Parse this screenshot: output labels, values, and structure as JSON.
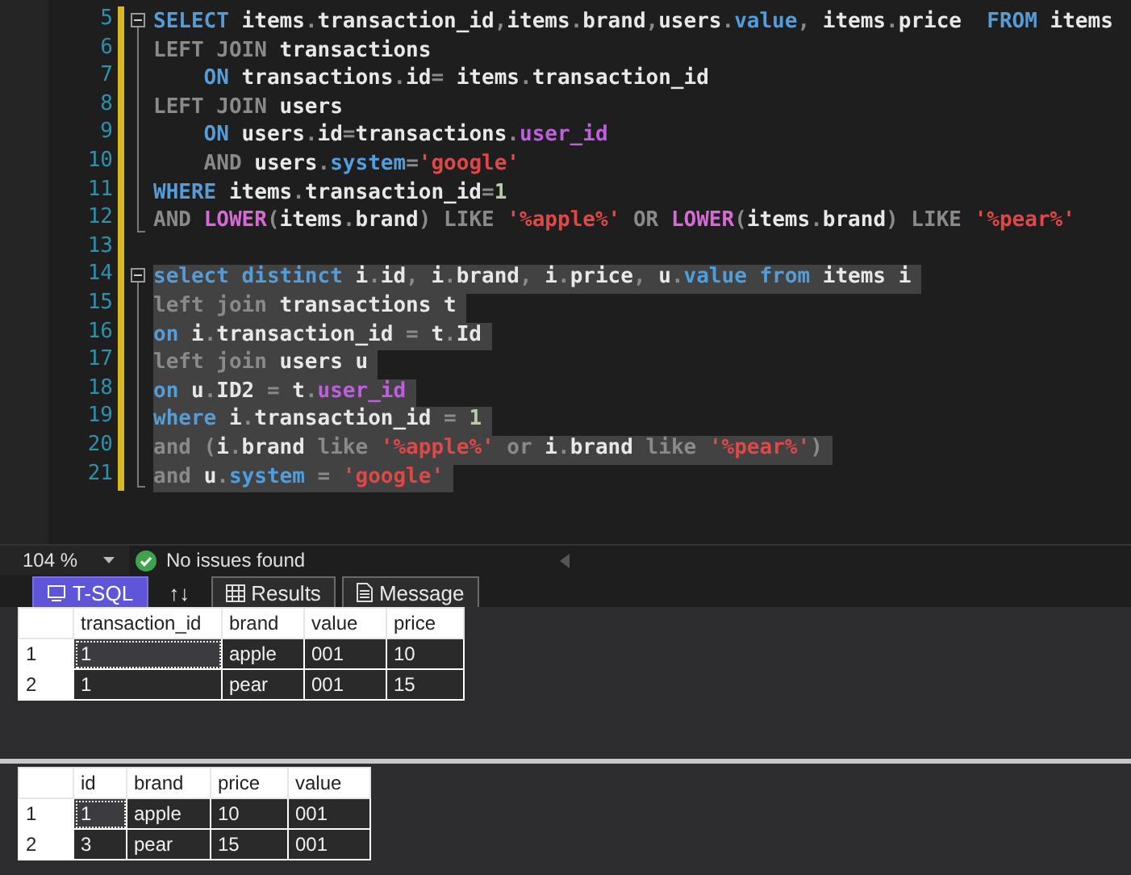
{
  "editor": {
    "lines": [
      {
        "number": "5",
        "kind": "block-start",
        "selected": false,
        "tokens": [
          {
            "kind": "keyword",
            "text": "SELECT"
          },
          {
            "kind": "ident",
            "text": " items"
          },
          {
            "kind": "gray",
            "text": "."
          },
          {
            "kind": "ident",
            "text": "transaction_id"
          },
          {
            "kind": "gray",
            "text": ","
          },
          {
            "kind": "ident",
            "text": "items"
          },
          {
            "kind": "gray",
            "text": "."
          },
          {
            "kind": "ident",
            "text": "brand"
          },
          {
            "kind": "gray",
            "text": ","
          },
          {
            "kind": "ident",
            "text": "users"
          },
          {
            "kind": "gray",
            "text": "."
          },
          {
            "kind": "member",
            "text": "value"
          },
          {
            "kind": "gray",
            "text": ","
          },
          {
            "kind": "ident",
            "text": " items"
          },
          {
            "kind": "gray",
            "text": "."
          },
          {
            "kind": "ident",
            "text": "price"
          },
          {
            "kind": "keyword",
            "text": "  FROM"
          },
          {
            "kind": "ident",
            "text": " items"
          }
        ]
      },
      {
        "number": "6",
        "kind": "block",
        "selected": false,
        "tokens": [
          {
            "kind": "gray",
            "text": "LEFT JOIN"
          },
          {
            "kind": "ident",
            "text": " transactions"
          }
        ]
      },
      {
        "number": "7",
        "kind": "block",
        "selected": false,
        "tokens": [
          {
            "kind": "keyword",
            "text": "    ON"
          },
          {
            "kind": "ident",
            "text": " transactions"
          },
          {
            "kind": "gray",
            "text": "."
          },
          {
            "kind": "ident",
            "text": "id"
          },
          {
            "kind": "gray",
            "text": "="
          },
          {
            "kind": "ident",
            "text": " items"
          },
          {
            "kind": "gray",
            "text": "."
          },
          {
            "kind": "ident",
            "text": "transaction_id"
          }
        ]
      },
      {
        "number": "8",
        "kind": "block",
        "selected": false,
        "tokens": [
          {
            "kind": "gray",
            "text": "LEFT JOIN"
          },
          {
            "kind": "ident",
            "text": " users"
          }
        ]
      },
      {
        "number": "9",
        "kind": "block",
        "selected": false,
        "tokens": [
          {
            "kind": "keyword",
            "text": "    ON"
          },
          {
            "kind": "ident",
            "text": " users"
          },
          {
            "kind": "gray",
            "text": "."
          },
          {
            "kind": "ident",
            "text": "id"
          },
          {
            "kind": "gray",
            "text": "="
          },
          {
            "kind": "ident",
            "text": "transactions"
          },
          {
            "kind": "gray",
            "text": "."
          },
          {
            "kind": "column",
            "text": "user_id"
          }
        ]
      },
      {
        "number": "10",
        "kind": "block",
        "selected": false,
        "tokens": [
          {
            "kind": "gray",
            "text": "    AND"
          },
          {
            "kind": "ident",
            "text": " users"
          },
          {
            "kind": "gray",
            "text": "."
          },
          {
            "kind": "member",
            "text": "system"
          },
          {
            "kind": "gray",
            "text": "="
          },
          {
            "kind": "string",
            "text": "'google'"
          }
        ]
      },
      {
        "number": "11",
        "kind": "block",
        "selected": false,
        "tokens": [
          {
            "kind": "keyword",
            "text": "WHERE"
          },
          {
            "kind": "ident",
            "text": " items"
          },
          {
            "kind": "gray",
            "text": "."
          },
          {
            "kind": "ident",
            "text": "transaction_id"
          },
          {
            "kind": "gray",
            "text": "="
          },
          {
            "kind": "number",
            "text": "1"
          }
        ]
      },
      {
        "number": "12",
        "kind": "block-end",
        "selected": false,
        "tokens": [
          {
            "kind": "gray",
            "text": "AND "
          },
          {
            "kind": "function",
            "text": "LOWER"
          },
          {
            "kind": "gray",
            "text": "("
          },
          {
            "kind": "ident",
            "text": "items"
          },
          {
            "kind": "gray",
            "text": "."
          },
          {
            "kind": "ident",
            "text": "brand"
          },
          {
            "kind": "gray",
            "text": ") LIKE "
          },
          {
            "kind": "string",
            "text": "'%apple%'"
          },
          {
            "kind": "gray",
            "text": " OR "
          },
          {
            "kind": "function",
            "text": "LOWER"
          },
          {
            "kind": "gray",
            "text": "("
          },
          {
            "kind": "ident",
            "text": "items"
          },
          {
            "kind": "gray",
            "text": "."
          },
          {
            "kind": "ident",
            "text": "brand"
          },
          {
            "kind": "gray",
            "text": ") LIKE "
          },
          {
            "kind": "string",
            "text": "'%pear%'"
          }
        ]
      },
      {
        "number": "13",
        "kind": "plain"
      },
      {
        "number": "14",
        "kind": "block-start",
        "selected": true,
        "tokens": [
          {
            "kind": "keyword",
            "text": "select distinct"
          },
          {
            "kind": "ident",
            "text": " i"
          },
          {
            "kind": "gray",
            "text": "."
          },
          {
            "kind": "ident",
            "text": "id"
          },
          {
            "kind": "gray",
            "text": ", "
          },
          {
            "kind": "ident",
            "text": "i"
          },
          {
            "kind": "gray",
            "text": "."
          },
          {
            "kind": "ident",
            "text": "brand"
          },
          {
            "kind": "gray",
            "text": ", "
          },
          {
            "kind": "ident",
            "text": "i"
          },
          {
            "kind": "gray",
            "text": "."
          },
          {
            "kind": "ident",
            "text": "price"
          },
          {
            "kind": "gray",
            "text": ", "
          },
          {
            "kind": "ident",
            "text": "u"
          },
          {
            "kind": "gray",
            "text": "."
          },
          {
            "kind": "member",
            "text": "value"
          },
          {
            "kind": "keyword",
            "text": " from"
          },
          {
            "kind": "ident",
            "text": " items i"
          }
        ]
      },
      {
        "number": "15",
        "kind": "block",
        "selected": true,
        "tokens": [
          {
            "kind": "gray",
            "text": "left join"
          },
          {
            "kind": "ident",
            "text": " transactions t"
          }
        ]
      },
      {
        "number": "16",
        "kind": "block",
        "selected": true,
        "tokens": [
          {
            "kind": "keyword",
            "text": "on"
          },
          {
            "kind": "ident",
            "text": " i"
          },
          {
            "kind": "gray",
            "text": "."
          },
          {
            "kind": "ident",
            "text": "transaction_id"
          },
          {
            "kind": "gray",
            "text": " = "
          },
          {
            "kind": "ident",
            "text": "t"
          },
          {
            "kind": "gray",
            "text": "."
          },
          {
            "kind": "ident",
            "text": "Id"
          }
        ]
      },
      {
        "number": "17",
        "kind": "block",
        "selected": true,
        "tokens": [
          {
            "kind": "gray",
            "text": "left join"
          },
          {
            "kind": "ident",
            "text": " users u"
          }
        ]
      },
      {
        "number": "18",
        "kind": "block",
        "selected": true,
        "tokens": [
          {
            "kind": "keyword",
            "text": "on"
          },
          {
            "kind": "ident",
            "text": " u"
          },
          {
            "kind": "gray",
            "text": "."
          },
          {
            "kind": "ident",
            "text": "ID2"
          },
          {
            "kind": "gray",
            "text": " = "
          },
          {
            "kind": "ident",
            "text": "t"
          },
          {
            "kind": "gray",
            "text": "."
          },
          {
            "kind": "column",
            "text": "user_id"
          }
        ]
      },
      {
        "number": "19",
        "kind": "block",
        "selected": true,
        "tokens": [
          {
            "kind": "keyword",
            "text": "where"
          },
          {
            "kind": "ident",
            "text": " i"
          },
          {
            "kind": "gray",
            "text": "."
          },
          {
            "kind": "ident",
            "text": "transaction_id"
          },
          {
            "kind": "gray",
            "text": " = "
          },
          {
            "kind": "number",
            "text": "1"
          }
        ]
      },
      {
        "number": "20",
        "kind": "block",
        "selected": true,
        "tokens": [
          {
            "kind": "gray",
            "text": "and ("
          },
          {
            "kind": "ident",
            "text": "i"
          },
          {
            "kind": "gray",
            "text": "."
          },
          {
            "kind": "ident",
            "text": "brand"
          },
          {
            "kind": "gray",
            "text": " like "
          },
          {
            "kind": "string",
            "text": "'%apple%'"
          },
          {
            "kind": "gray",
            "text": " or "
          },
          {
            "kind": "ident",
            "text": "i"
          },
          {
            "kind": "gray",
            "text": "."
          },
          {
            "kind": "ident",
            "text": "brand"
          },
          {
            "kind": "gray",
            "text": " like "
          },
          {
            "kind": "string",
            "text": "'%pear%'"
          },
          {
            "kind": "gray",
            "text": ")"
          }
        ]
      },
      {
        "number": "21",
        "kind": "block-end",
        "selected": true,
        "tokens": [
          {
            "kind": "gray",
            "text": "and "
          },
          {
            "kind": "ident",
            "text": "u"
          },
          {
            "kind": "gray",
            "text": "."
          },
          {
            "kind": "member",
            "text": "system"
          },
          {
            "kind": "gray",
            "text": " = "
          },
          {
            "kind": "string",
            "text": "'google'"
          }
        ]
      }
    ]
  },
  "status_bar": {
    "zoom": "104 %",
    "message": "No issues found"
  },
  "tabs": [
    {
      "label": "T-SQL",
      "kind": "mode",
      "selected": true
    },
    {
      "label": "↑↓",
      "kind": "toggle",
      "selected": false
    },
    {
      "label": "Results",
      "kind": "grid",
      "selected": false
    },
    {
      "label": "Message",
      "kind": "doc",
      "selected": false
    }
  ],
  "results": [
    {
      "columns": [
        "transaction_id",
        "brand",
        "value",
        "price"
      ],
      "rows": [
        {
          "number": "1",
          "cells": [
            {
              "text": "1",
              "selected": true
            },
            {
              "text": "apple",
              "selected": false
            },
            {
              "text": "001",
              "selected": false
            },
            {
              "text": "10",
              "selected": false
            }
          ]
        },
        {
          "number": "2",
          "cells": [
            {
              "text": "1",
              "selected": false
            },
            {
              "text": "pear",
              "selected": false
            },
            {
              "text": "001",
              "selected": false
            },
            {
              "text": "15",
              "selected": false
            }
          ]
        }
      ]
    },
    {
      "columns": [
        "id",
        "brand",
        "price",
        "value"
      ],
      "rows": [
        {
          "number": "1",
          "cells": [
            {
              "text": "1",
              "selected": true
            },
            {
              "text": "apple",
              "selected": false
            },
            {
              "text": "10",
              "selected": false
            },
            {
              "text": "001",
              "selected": false
            }
          ]
        },
        {
          "number": "2",
          "cells": [
            {
              "text": "3",
              "selected": false
            },
            {
              "text": "pear",
              "selected": false
            },
            {
              "text": "15",
              "selected": false
            },
            {
              "text": "001",
              "selected": false
            }
          ]
        }
      ]
    }
  ]
}
